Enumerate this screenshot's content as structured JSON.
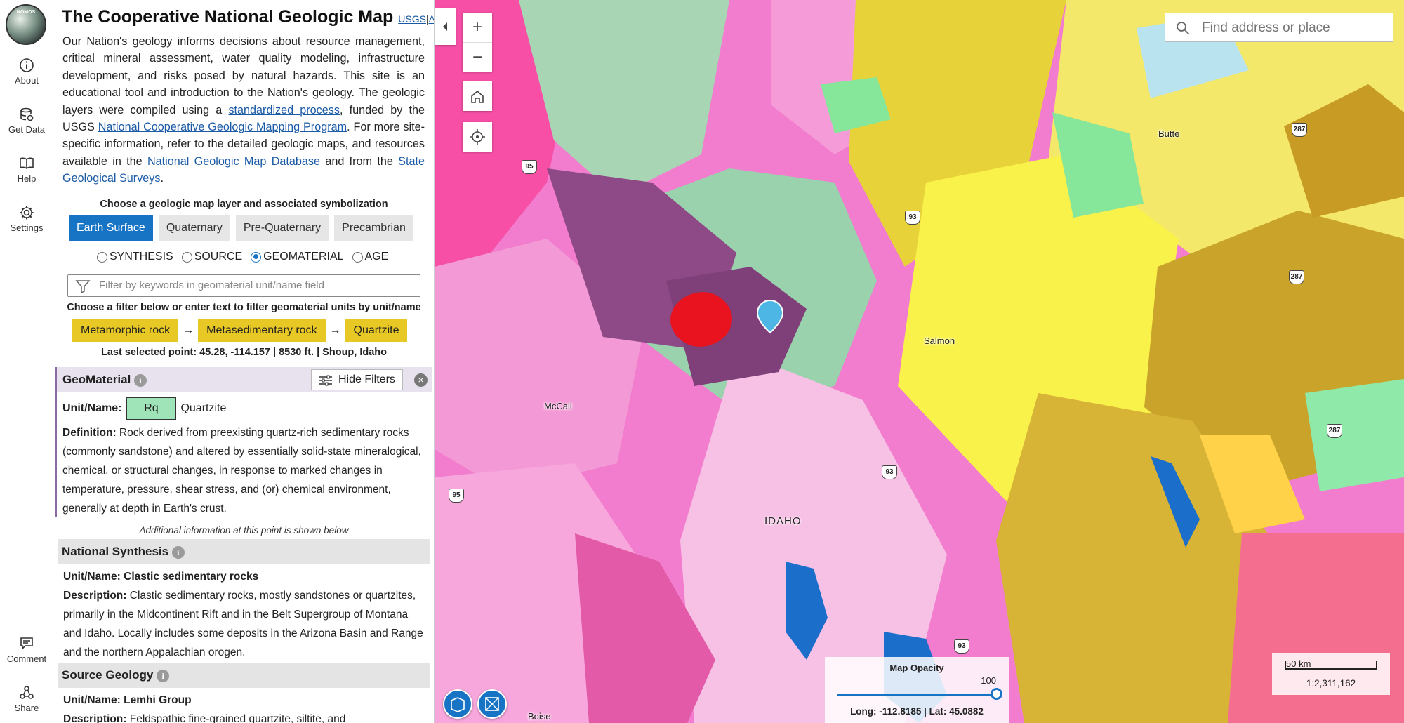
{
  "rail": {
    "logo_text": "NOMOS",
    "items": [
      {
        "label": "About",
        "icon": "info-icon"
      },
      {
        "label": "Get Data",
        "icon": "database-icon"
      },
      {
        "label": "Help",
        "icon": "book-icon"
      },
      {
        "label": "Settings",
        "icon": "gear-icon"
      },
      {
        "label": "Comment",
        "icon": "comment-icon"
      },
      {
        "label": "Share",
        "icon": "share-icon"
      }
    ]
  },
  "panel": {
    "title": "The Cooperative National Geologic Map",
    "link_usgs": "USGS",
    "link_sep": "|",
    "link_aasg": "AASG",
    "intro": {
      "p1": "Our Nation's geology informs decisions about resource management, critical mineral assessment, water quality modeling, infrastructure development, and risks posed by natural hazards. This site is an educational tool and introduction to the Nation's geology. The geologic layers were compiled using a ",
      "link1": "standardized process",
      "p2": ", funded by the USGS ",
      "link2": "National Cooperative Geologic Mapping Program",
      "p3": ". For more site-specific information, refer to the detailed geologic maps, and resources available in the ",
      "link3": "National Geologic Map Database",
      "p4": " and from the ",
      "link4": "State Geological Surveys",
      "p5": "."
    },
    "choose_layer": "Choose a geologic map layer and associated symbolization",
    "tabs": [
      "Earth Surface",
      "Quaternary",
      "Pre-Quaternary",
      "Precambrian"
    ],
    "radios": [
      "SYNTHESIS",
      "SOURCE",
      "GEOMATERIAL",
      "AGE"
    ],
    "filter_placeholder": "Filter by keywords in geomaterial unit/name field",
    "choose_filter": "Choose a filter below or enter text to filter geomaterial units by unit/name",
    "chips": [
      "Metamorphic rock",
      "Metasedimentary rock",
      "Quartzite"
    ],
    "chip_arrow": "→",
    "last_point": "Last selected point: 45.28, -114.157 | 8530 ft. | Shoup, Idaho",
    "geomaterial": {
      "heading": "GeoMaterial",
      "hide_filters": "Hide Filters",
      "unit_label": "Unit/Name:",
      "unit_code": "Rq",
      "unit_name": "Quartzite",
      "definition_label": "Definition:",
      "definition": " Rock derived from preexisting quartz-rich sedimentary rocks (commonly sandstone) and altered by essentially solid-state mineralogical, chemical, or structural changes, in response to marked changes in temperature, pressure, shear stress, and (or) chemical environment, generally at depth in Earth's crust."
    },
    "additional": "Additional information at this point is shown below",
    "synthesis": {
      "heading": "National Synthesis",
      "unit": "Unit/Name: Clastic sedimentary rocks",
      "desc_label": "Description:",
      "desc": " Clastic sedimentary rocks, mostly sandstones or quartzites, primarily in the Midcontinent Rift and in the Belt Supergroup of Montana and Idaho. Locally includes some deposits in the Arizona Basin and Range and the northern Appalachian orogen."
    },
    "source": {
      "heading": "Source Geology",
      "unit": "Unit/Name: Lemhi Group",
      "desc_label": "Description:",
      "desc": " Feldspathic fine-grained quartzite, siltite, and"
    }
  },
  "map": {
    "zoom_in": "+",
    "zoom_out": "−",
    "search_placeholder": "Find address or place",
    "places": [
      "Butte",
      "Salmon",
      "McCall",
      "IDAHO",
      "Boise"
    ],
    "shields": [
      "95",
      "93",
      "287",
      "287",
      "287",
      "93",
      "95",
      "93"
    ],
    "opacity_label": "Map Opacity",
    "opacity_value": "100",
    "coords": "Long: -112.8185 | Lat: 45.0882",
    "scale_km": "50 km",
    "scale_ratio": "1:2,311,162"
  },
  "colors": {
    "accent": "#1774c5",
    "chip": "#e8c825",
    "unit_swatch": "#9fe3b9",
    "selection": "#e8131e"
  }
}
